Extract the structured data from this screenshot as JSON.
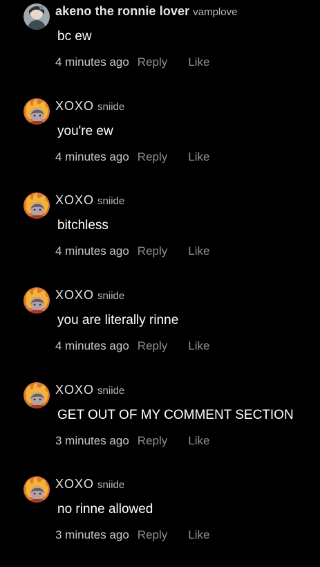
{
  "comments": [
    {
      "display_name": "akeno the ronnie lover",
      "username": "vamplove",
      "text": "bc ew",
      "time": "4 minutes ago",
      "reply_label": "Reply",
      "like_label": "Like",
      "avatar": "akeno-avatar"
    },
    {
      "display_name": "XOXO",
      "username": "sniide",
      "text": "you're ew",
      "time": "4 minutes ago",
      "reply_label": "Reply",
      "like_label": "Like",
      "avatar": "fire-avatar"
    },
    {
      "display_name": "XOXO",
      "username": "sniide",
      "text": "bitchless",
      "time": "4 minutes ago",
      "reply_label": "Reply",
      "like_label": "Like",
      "avatar": "fire-avatar"
    },
    {
      "display_name": "XOXO",
      "username": "sniide",
      "text": "you are literally rinne",
      "time": "4 minutes ago",
      "reply_label": "Reply",
      "like_label": "Like",
      "avatar": "fire-avatar"
    },
    {
      "display_name": "XOXO",
      "username": "sniide",
      "text": "GET OUT OF MY COMMENT SECTION",
      "time": "3 minutes ago",
      "reply_label": "Reply",
      "like_label": "Like",
      "avatar": "fire-avatar"
    },
    {
      "display_name": "XOXO",
      "username": "sniide",
      "text": "no rinne allowed",
      "time": "3 minutes ago",
      "reply_label": "Reply",
      "like_label": "Like",
      "avatar": "fire-avatar"
    }
  ],
  "colors": {
    "background": "#000000",
    "text": "#ffffff",
    "name": "#e4e4e8",
    "secondary": "#8e8e98"
  }
}
